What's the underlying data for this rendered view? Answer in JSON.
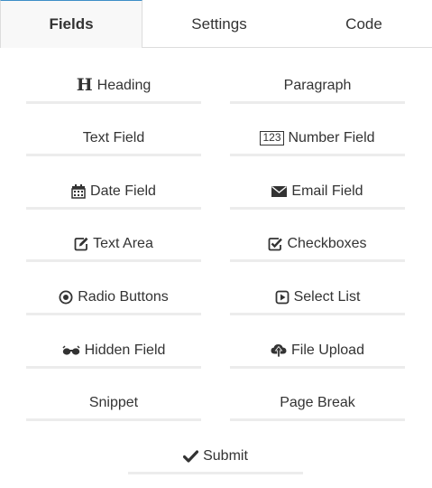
{
  "tabs": [
    {
      "label": "Fields",
      "active": true
    },
    {
      "label": "Settings",
      "active": false
    },
    {
      "label": "Code",
      "active": false
    }
  ],
  "fields": {
    "heading": {
      "label": "Heading",
      "icon": "heading-icon",
      "glyph": "H"
    },
    "paragraph": {
      "label": "Paragraph"
    },
    "text_field": {
      "label": "Text Field"
    },
    "number_field": {
      "label": "Number Field",
      "icon": "number-icon",
      "glyph": "123"
    },
    "date_field": {
      "label": "Date Field",
      "icon": "calendar-icon"
    },
    "email_field": {
      "label": "Email Field",
      "icon": "envelope-icon"
    },
    "text_area": {
      "label": "Text Area",
      "icon": "edit-icon"
    },
    "checkboxes": {
      "label": "Checkboxes",
      "icon": "check-square-icon"
    },
    "radio_buttons": {
      "label": "Radio Buttons",
      "icon": "radio-icon"
    },
    "select_list": {
      "label": "Select List",
      "icon": "select-icon"
    },
    "hidden_field": {
      "label": "Hidden Field",
      "icon": "glasses-icon"
    },
    "file_upload": {
      "label": "File Upload",
      "icon": "cloud-upload-icon"
    },
    "snippet": {
      "label": "Snippet"
    },
    "page_break": {
      "label": "Page Break"
    },
    "submit": {
      "label": "Submit",
      "icon": "checkmark-icon"
    }
  },
  "colors": {
    "active_tab_border": "#3d8fc7",
    "active_tab_bg": "#f8f8f8",
    "text": "#333333",
    "button_underline": "#ececec"
  }
}
